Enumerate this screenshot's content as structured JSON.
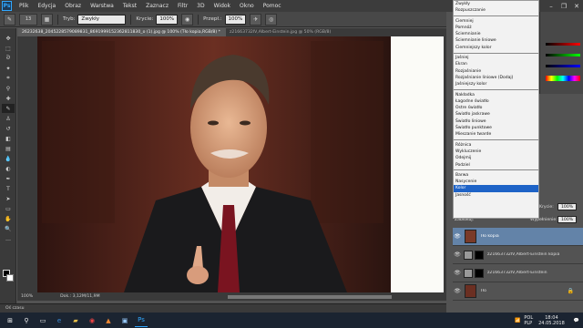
{
  "menubar": {
    "logo": "Ps",
    "items": [
      "Plik",
      "Edycja",
      "Obraz",
      "Warstwa",
      "Tekst",
      "Zaznacz",
      "Filtr",
      "3D",
      "Widok",
      "Okno",
      "Pomoc"
    ],
    "window_controls": [
      "–",
      "❐",
      "✕"
    ]
  },
  "options": {
    "brush_size": "13",
    "mode_label": "Tryb:",
    "mode_value": "Zwykły",
    "opacity_label": "Krycie:",
    "opacity_value": "100%",
    "flow_label": "Przepł.:",
    "flow_value": "100%"
  },
  "tabs": [
    {
      "label": "26232638_2045228579089831_869199915236281183​0_o (1).jpg @ 100% (Tło kopia,RGB/8) *",
      "active": true
    },
    {
      "label": "z21663732IV,Albert-Einstein.jpg @ 50% (RGB/8)",
      "active": false
    }
  ],
  "status": {
    "zoom": "100%",
    "doc": "Dok.: 3,12M/11,9M"
  },
  "timeline": {
    "label": "Oś czasu"
  },
  "blend_menu": {
    "groups": [
      [
        "Zwykły",
        "Rozpuszczanie"
      ],
      [
        "Ciemniej",
        "Pomnóż",
        "Ściemnianie",
        "Ściemnianie liniowe",
        "Ciemniejszy kolor"
      ],
      [
        "Jaśniej",
        "Ekran",
        "Rozjaśnianie",
        "Rozjaśnianie liniowe (Dodaj)",
        "Jaśniejszy kolor"
      ],
      [
        "Nakładka",
        "Łagodne światło",
        "Ostre światło",
        "Światło jaskrawe",
        "Światło liniowe",
        "Światło punktowe",
        "Mieszanie twarde"
      ],
      [
        "Różnica",
        "Wykluczenie",
        "Odejmij",
        "Podziel"
      ],
      [
        "Barwa",
        "Nasycenie",
        "Kolor",
        "Jasność"
      ]
    ],
    "highlighted": "Kolor"
  },
  "layers_panel": {
    "opacity_label": "Krycie:",
    "opacity_value": "100%",
    "fill_label": "Wypełnienie:",
    "fill_value": "100%",
    "lock_label": "Zablokuj:",
    "layers": [
      {
        "name": "Tło kopia",
        "selected": true
      },
      {
        "name": "z21663732IV,Albert-Einstein kopia",
        "selected": false
      },
      {
        "name": "z21663732IV,Albert-Einstein",
        "selected": false
      },
      {
        "name": "Tło",
        "selected": false
      }
    ]
  },
  "taskbar": {
    "lang": "POL",
    "lang2": "PLP",
    "time": "18:04",
    "date": "24.05.2018"
  },
  "colors": {
    "accent": "#6383a8",
    "menu_highlight": "#1e63c7"
  }
}
